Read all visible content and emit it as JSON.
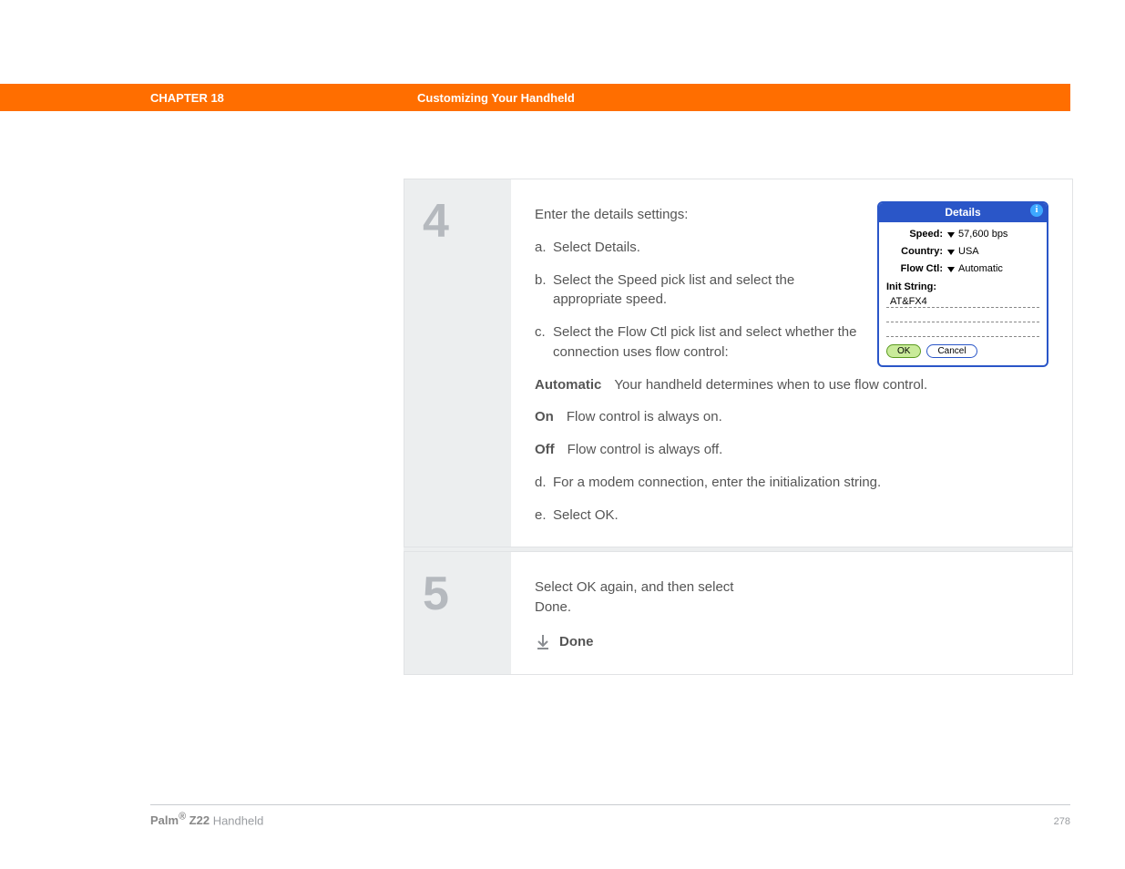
{
  "header": {
    "chapter": "CHAPTER 18",
    "title": "Customizing Your Handheld"
  },
  "step4": {
    "number": "4",
    "intro": "Enter the details settings:",
    "items": {
      "a_letter": "a.",
      "a_text": "Select Details.",
      "b_letter": "b.",
      "b_text": "Select the Speed pick list and select the appropriate speed.",
      "c_letter": "c.",
      "c_text": "Select the Flow Ctl pick list and select whether the connection uses flow control:"
    },
    "defs": {
      "auto_term": "Automatic",
      "auto_desc": "Your handheld determines when to use flow control.",
      "on_term": "On",
      "on_desc": "Flow control is always on.",
      "off_term": "Off",
      "off_desc": "Flow control is always off."
    },
    "items2": {
      "d_letter": "d.",
      "d_text": "For a modem connection, enter the initialization string.",
      "e_letter": "e.",
      "e_text": "Select OK."
    },
    "dialog": {
      "title": "Details",
      "speed_label": "Speed:",
      "speed_value": "57,600 bps",
      "country_label": "Country:",
      "country_value": "USA",
      "flow_label": "Flow Ctl:",
      "flow_value": "Automatic",
      "init_label": "Init String:",
      "init_value": "AT&FX4",
      "ok": "OK",
      "cancel": "Cancel"
    }
  },
  "step5": {
    "number": "5",
    "text": "Select OK again, and then select Done.",
    "done": "Done"
  },
  "footer": {
    "product_brand": "Palm",
    "product_reg": "®",
    "product_model": " Z22 ",
    "product_suffix": "Handheld",
    "page": "278"
  }
}
